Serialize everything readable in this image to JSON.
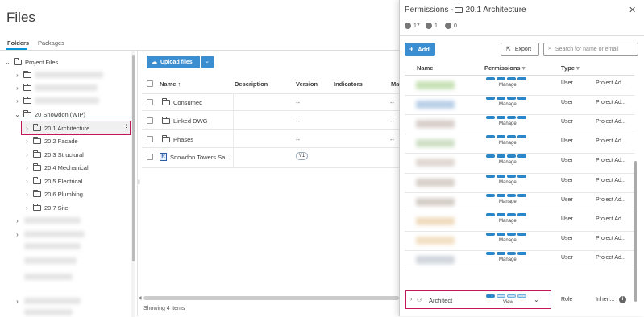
{
  "files": {
    "title": "Files",
    "tabs": [
      "Folders",
      "Packages"
    ],
    "tree": {
      "root": "Project Files",
      "snowdon": "20 Snowdon (WIP)",
      "children": [
        "20.1 Architecture",
        "20.2 Facade",
        "20.3 Structural",
        "20.4 Mechanical",
        "20.5 Electrical",
        "20.6 Plumbing",
        "20.7 Site"
      ],
      "more_icon": "⋮"
    },
    "upload_label": "Upload files",
    "columns": [
      "Name",
      "Description",
      "Version",
      "Indicators",
      "Ma"
    ],
    "rows": [
      {
        "name": "Consumed",
        "version": "--",
        "indicators": "--"
      },
      {
        "name": "Linked DWG",
        "version": "--",
        "indicators": "--"
      },
      {
        "name": "Phases",
        "version": "--",
        "indicators": "--"
      },
      {
        "name": "Snowdon Towers Sa...",
        "version": "V1",
        "indicators": ""
      }
    ],
    "status": "Showing 4 items"
  },
  "permissions": {
    "title_prefix": "Permissions - ",
    "folder": "20.1 Architecture",
    "counts": {
      "users": "17",
      "companies": "1",
      "roles": "0"
    },
    "add_label": "Add",
    "export_label": "Export",
    "search_placeholder": "Search for name or email",
    "columns": [
      "Name",
      "Permissions",
      "Type"
    ],
    "rows": [
      {
        "perm": "Manage",
        "type": "User",
        "inherited": "Project Ad..."
      },
      {
        "perm": "Manage",
        "type": "User",
        "inherited": "Project Ad..."
      },
      {
        "perm": "Manage",
        "type": "User",
        "inherited": "Project Ad..."
      },
      {
        "perm": "Manage",
        "type": "User",
        "inherited": "Project Ad..."
      },
      {
        "perm": "Manage",
        "type": "User",
        "inherited": "Project Ad..."
      },
      {
        "perm": "Manage",
        "type": "User",
        "inherited": "Project Ad..."
      },
      {
        "perm": "Manage",
        "type": "User",
        "inherited": "Project Ad..."
      },
      {
        "perm": "Manage",
        "type": "User",
        "inherited": "Project Ad..."
      },
      {
        "perm": "Manage",
        "type": "User",
        "inherited": "Project Ad..."
      },
      {
        "perm": "Manage",
        "type": "User",
        "inherited": "Project Ad..."
      }
    ],
    "architect": {
      "name": "Architect",
      "perm": "View",
      "type": "Role",
      "inherited": "Inheri..."
    }
  },
  "colors": {
    "accent": "#3b8fd1",
    "highlight": "#c2185b"
  }
}
